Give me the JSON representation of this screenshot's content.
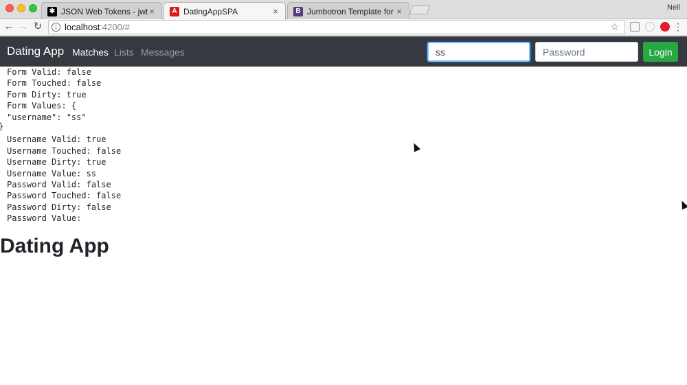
{
  "browser": {
    "tabs": [
      {
        "title": "JSON Web Tokens - jwt.io",
        "close": "×"
      },
      {
        "title": "DatingAppSPA",
        "close": "×"
      },
      {
        "title": "Jumbotron Template for Bootst",
        "close": "×"
      }
    ],
    "profile_name": "Neil",
    "url_host": "localhost",
    "url_rest": ":4200/#",
    "back_glyph": "←",
    "forward_glyph": "→",
    "reload_glyph": "↻",
    "info_glyph": "i",
    "star_glyph": "☆",
    "menu_glyph": "⋮"
  },
  "navbar": {
    "brand": "Dating App",
    "links": [
      "Matches",
      "Lists",
      "Messages"
    ],
    "username_value": "ss",
    "password_placeholder": "Password",
    "login_label": "Login"
  },
  "debug_lines": [
    "Form Valid: false",
    "Form Touched: false",
    "Form Dirty: true",
    "Form Values: {",
    "\"username\": \"ss\"",
    "",
    "Username Valid: true",
    "Username Touched: false",
    "Username Dirty: true",
    "Username Value: ss",
    "Password Valid: false",
    "Password Touched: false",
    "Password Dirty: false",
    "Password Value:"
  ],
  "closing_brace": "}",
  "heading": "Dating App",
  "colors": {
    "navbar_bg": "#343a40",
    "login_green": "#28a745",
    "focus_blue": "#80bdff"
  }
}
